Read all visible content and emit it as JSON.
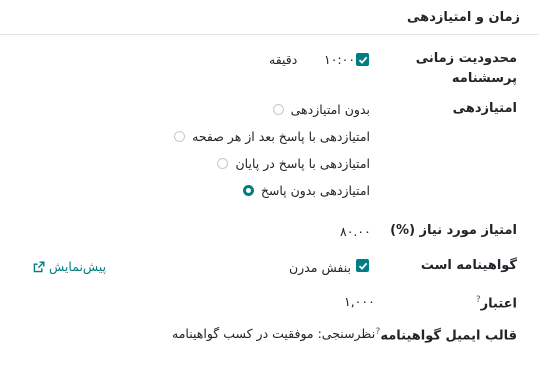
{
  "section": {
    "title": "زمان و امتیازدهی"
  },
  "time_limit": {
    "label_line1": "محدودیت زمانی",
    "label_line2": "پرسشنامه",
    "checked": true,
    "value": "۱۰:۰۰",
    "unit": "دقیقه"
  },
  "scoring": {
    "label": "امتیازدهی",
    "options": [
      {
        "label": "بدون امتیازدهی",
        "selected": false
      },
      {
        "label": "امتیازدهی با پاسخ بعد از هر صفحه",
        "selected": false
      },
      {
        "label": "امتیازدهی با پاسخ در پایان",
        "selected": false
      },
      {
        "label": "امتیازدهی بدون پاسخ",
        "selected": true
      }
    ]
  },
  "required_score": {
    "label": "امتیاز مورد نیاز (%)",
    "value": "۸۰.۰۰"
  },
  "certificate": {
    "label": "گواهینامه است",
    "checked": true,
    "value": "بنفش مدرن",
    "preview_label": "پیش‌نمایش"
  },
  "credit": {
    "label": "اعتبار",
    "help": "?",
    "value": "۱,۰۰۰"
  },
  "certificate_email": {
    "label": "قالب ایمیل گواهینامه",
    "help": "?",
    "value": "نظرسنجی: موفقیت در کسب گواهینامه"
  },
  "colors": {
    "accent": "#017e84",
    "text": "#212529"
  }
}
